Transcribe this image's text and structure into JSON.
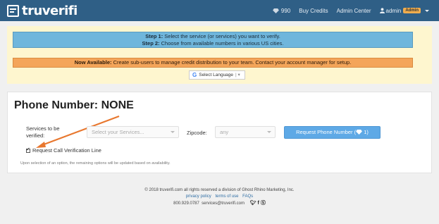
{
  "brand": {
    "name": "truverifi"
  },
  "nav": {
    "credits": "990",
    "buy_credits": "Buy Credits",
    "admin_center": "Admin Center",
    "username": "admin",
    "role_badge": "Admin"
  },
  "notice": {
    "step1_label": "Step 1:",
    "step1_text": " Select the service (or services) you want to verify.",
    "step2_label": "Step 2:",
    "step2_text": " Choose from available numbers in various US cities.",
    "now_label": "Now Available:",
    "now_text": " Create sub-users to manage credit distribution to your team. Contact your account manager for setup.",
    "language_label": "Select Language"
  },
  "main": {
    "title": "Phone Number: NONE",
    "services_label": "Services to be verified:",
    "services_placeholder": "Select your Services...",
    "zipcode_label": "Zipcode:",
    "zipcode_value": "any",
    "request_button": "Request Phone Number (",
    "request_button_count": "1)",
    "call_verification_label": "Request Call Verification Line",
    "call_verification_checked": true,
    "hint": "Upon selection of an option, the remaining options will be updated based on availability."
  },
  "footer": {
    "copyright": "© 2018 truverifi.com  all rights reserved  a division of Ghost Rhino Marketing, Inc.",
    "privacy": "privacy policy",
    "terms": "terms of use",
    "faqs": "FAQs",
    "phone": "800.929.0787",
    "email": "services@truverifi.com"
  },
  "colors": {
    "topbar": "#2f5f86",
    "steps_bg": "#6fb6dc",
    "now_bg": "#f4a55a",
    "notice_bg": "#fef6cf",
    "button": "#5ea9e6",
    "arrow": "#e8772e"
  }
}
